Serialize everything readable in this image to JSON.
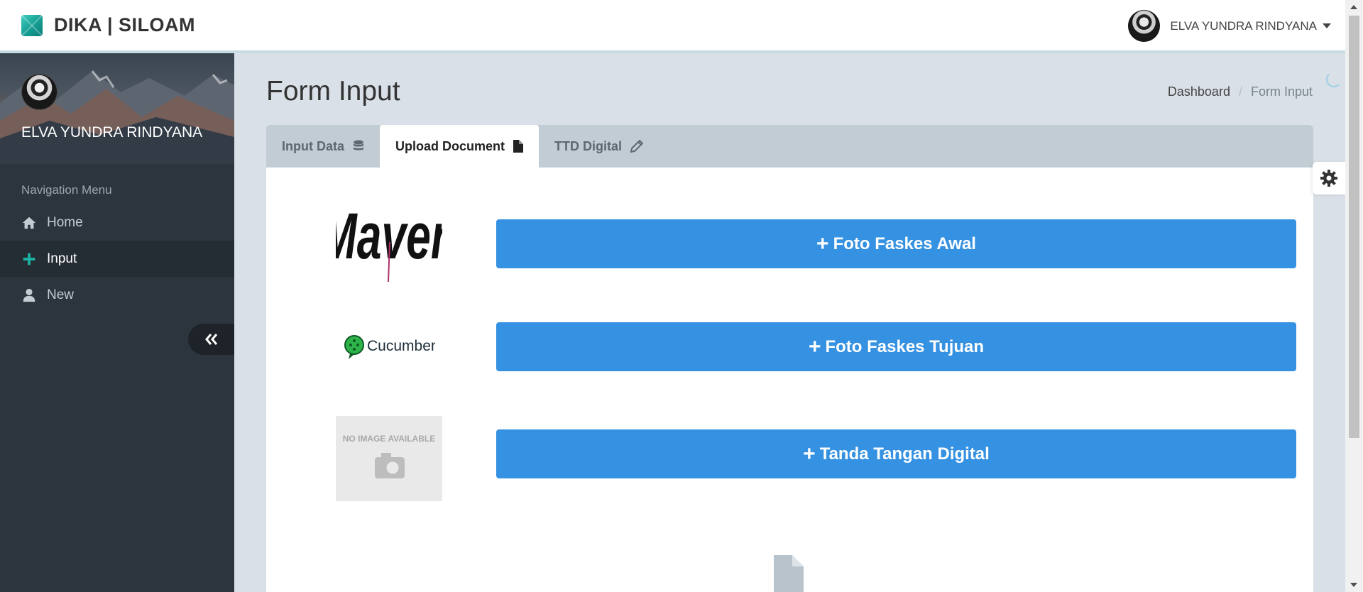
{
  "app": {
    "brand": "DIKA | SILOAM"
  },
  "header": {
    "user_name": "ELVA YUNDRA RINDYANA"
  },
  "sidebar": {
    "profile_name": "ELVA YUNDRA RINDYANA",
    "nav_title": "Navigation Menu",
    "items": [
      {
        "label": "Home",
        "icon": "home-icon"
      },
      {
        "label": "Input",
        "icon": "plus-icon",
        "active": true
      },
      {
        "label": "New",
        "icon": "user-icon"
      }
    ]
  },
  "main": {
    "title": "Form Input",
    "breadcrumb": [
      "Dashboard",
      "Form Input"
    ],
    "tabs": [
      {
        "label": "Input Data",
        "icon": "database-icon"
      },
      {
        "label": "Upload Document",
        "icon": "file-icon",
        "active": true
      },
      {
        "label": "TTD Digital",
        "icon": "pencil-icon"
      }
    ],
    "uploads": [
      {
        "label": "Foto Faskes Awal",
        "image": "Maven"
      },
      {
        "label": "Foto Faskes Tujuan",
        "image": "Cucumber"
      },
      {
        "label": "Tanda Tangan Digital",
        "image": "NO IMAGE AVAILABLE"
      }
    ]
  },
  "colors": {
    "primary": "#3591e1",
    "sidebar": "#2c353e",
    "accent": "#1cb5a6"
  }
}
